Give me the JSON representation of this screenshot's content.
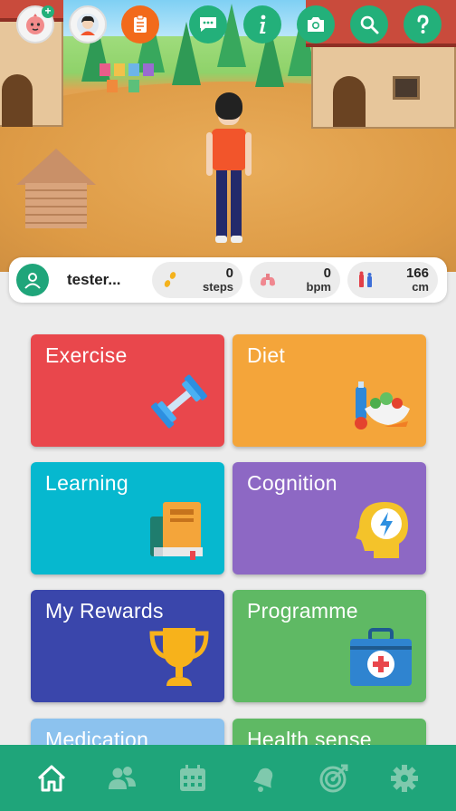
{
  "profile": {
    "username": "tester...",
    "stats": [
      {
        "value": "0",
        "unit": "steps",
        "icon": "footsteps-icon"
      },
      {
        "value": "0",
        "unit": "bpm",
        "icon": "lungs-icon"
      },
      {
        "value": "166",
        "unit": "cm",
        "icon": "height-icon"
      }
    ]
  },
  "top_buttons": [
    "pet-avatar",
    "user-avatar",
    "clipboard-icon",
    "chat-icon",
    "info-icon",
    "camera-icon",
    "search-icon",
    "help-icon"
  ],
  "tiles": [
    {
      "label": "Exercise",
      "color": "#e9474c",
      "icon": "dumbbell-icon"
    },
    {
      "label": "Diet",
      "color": "#f4a53a",
      "icon": "vegetables-icon"
    },
    {
      "label": "Learning",
      "color": "#06b8cf",
      "icon": "books-icon"
    },
    {
      "label": "Cognition",
      "color": "#8d68c4",
      "icon": "brain-head-icon"
    },
    {
      "label": "My Rewards",
      "color": "#3a46ab",
      "icon": "trophy-icon"
    },
    {
      "label": "Programme",
      "color": "#5fb964",
      "icon": "first-aid-kit-icon"
    },
    {
      "label": "Medication",
      "color": "#8cc2ee",
      "icon": "pill-icon"
    },
    {
      "label": "Health sense",
      "color": "#5fb964",
      "icon": "heart-icon"
    }
  ],
  "bottom_nav": [
    "home-icon",
    "friends-icon",
    "calendar-icon",
    "bell-icon",
    "target-icon",
    "settings-icon"
  ],
  "colors": {
    "brand": "#1fa57a",
    "nav_inactive": "#7fc9ad"
  }
}
